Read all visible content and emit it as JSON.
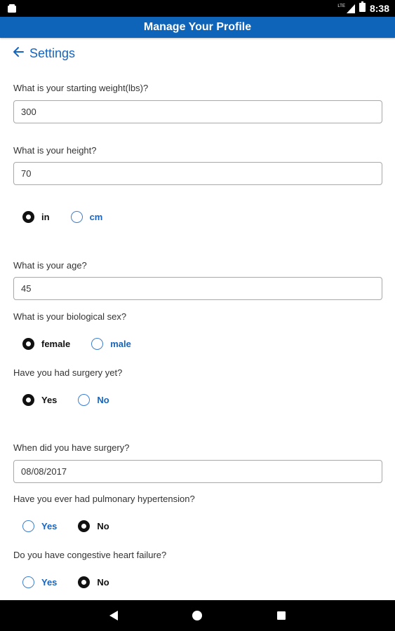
{
  "status_bar": {
    "time": "8:38",
    "network": "LTE"
  },
  "app_bar": {
    "title": "Manage Your Profile"
  },
  "back": {
    "label": "Settings"
  },
  "form": {
    "weight": {
      "label": "What is your starting weight(lbs)?",
      "value": "300"
    },
    "height": {
      "label": "What is your height?",
      "value": "70"
    },
    "height_unit": {
      "options": [
        "in",
        "cm"
      ],
      "selected": "in"
    },
    "age": {
      "label": "What is your age?",
      "value": "45"
    },
    "sex": {
      "label": "What is your biological sex?",
      "options": [
        "female",
        "male"
      ],
      "selected": "female"
    },
    "surgery": {
      "label": "Have you had surgery yet?",
      "options": [
        "Yes",
        "No"
      ],
      "selected": "Yes"
    },
    "surgery_date": {
      "label": "When did you have surgery?",
      "value": "08/08/2017"
    },
    "pulmonary": {
      "label": "Have you ever had pulmonary hypertension?",
      "options": [
        "Yes",
        "No"
      ],
      "selected": "No"
    },
    "chf": {
      "label": "Do you have congestive heart failure?",
      "options": [
        "Yes",
        "No"
      ],
      "selected": "No"
    }
  },
  "colors": {
    "primary": "#0d64b8",
    "link": "#1565c0",
    "status_bar": "#000000"
  },
  "icons": {
    "back": "arrow-left-icon",
    "nav_back": "triangle-back-icon",
    "nav_home": "circle-home-icon",
    "nav_recent": "square-recents-icon"
  }
}
